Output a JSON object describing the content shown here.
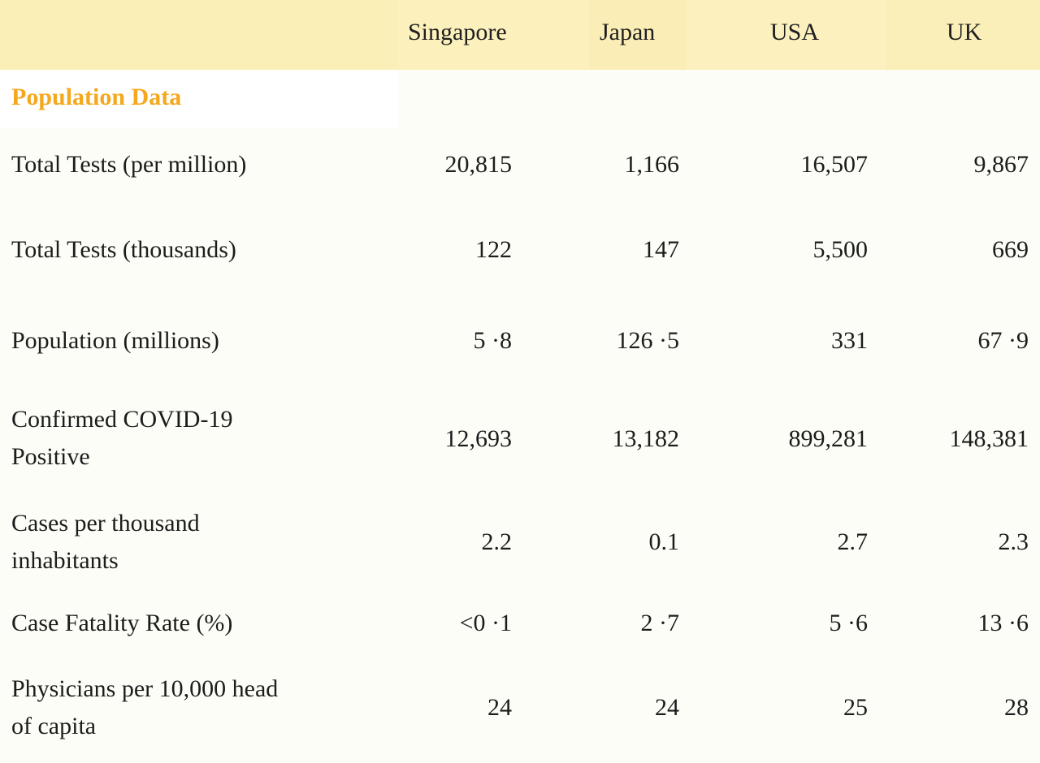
{
  "table": {
    "columns": [
      "",
      "Singapore",
      "Japan",
      "USA",
      "UK"
    ],
    "section_title": "Population Data",
    "rows": [
      {
        "label": "Total Tests (per million)",
        "values": [
          "20,815",
          "1,166",
          "16,507",
          "9,867"
        ]
      },
      {
        "label": "Total Tests (thousands)",
        "values": [
          "122",
          "147",
          "5,500",
          "669"
        ]
      },
      {
        "label": "Population (millions)",
        "values": [
          "5 ·8",
          "126 ·5",
          "331",
          "67 ·9"
        ]
      },
      {
        "label": "Confirmed COVID-19 Positive",
        "values": [
          "12,693",
          "13,182",
          "899,281",
          "148,381"
        ]
      },
      {
        "label": "Cases per thousand inhabitants",
        "values": [
          "2.2",
          "0.1",
          "2.7",
          "2.3"
        ]
      },
      {
        "label": "Case Fatality Rate (%)",
        "values": [
          "<0 ·1",
          "2 ·7",
          "5 ·6",
          "13 ·6"
        ]
      },
      {
        "label": "Physicians per 10,000 head of capita",
        "values": [
          "24",
          "24",
          "25",
          "28"
        ]
      }
    ]
  },
  "colors": {
    "header_band": "#fbefb9",
    "section_title": "#f5a81e",
    "background": "#fdfdf8"
  }
}
